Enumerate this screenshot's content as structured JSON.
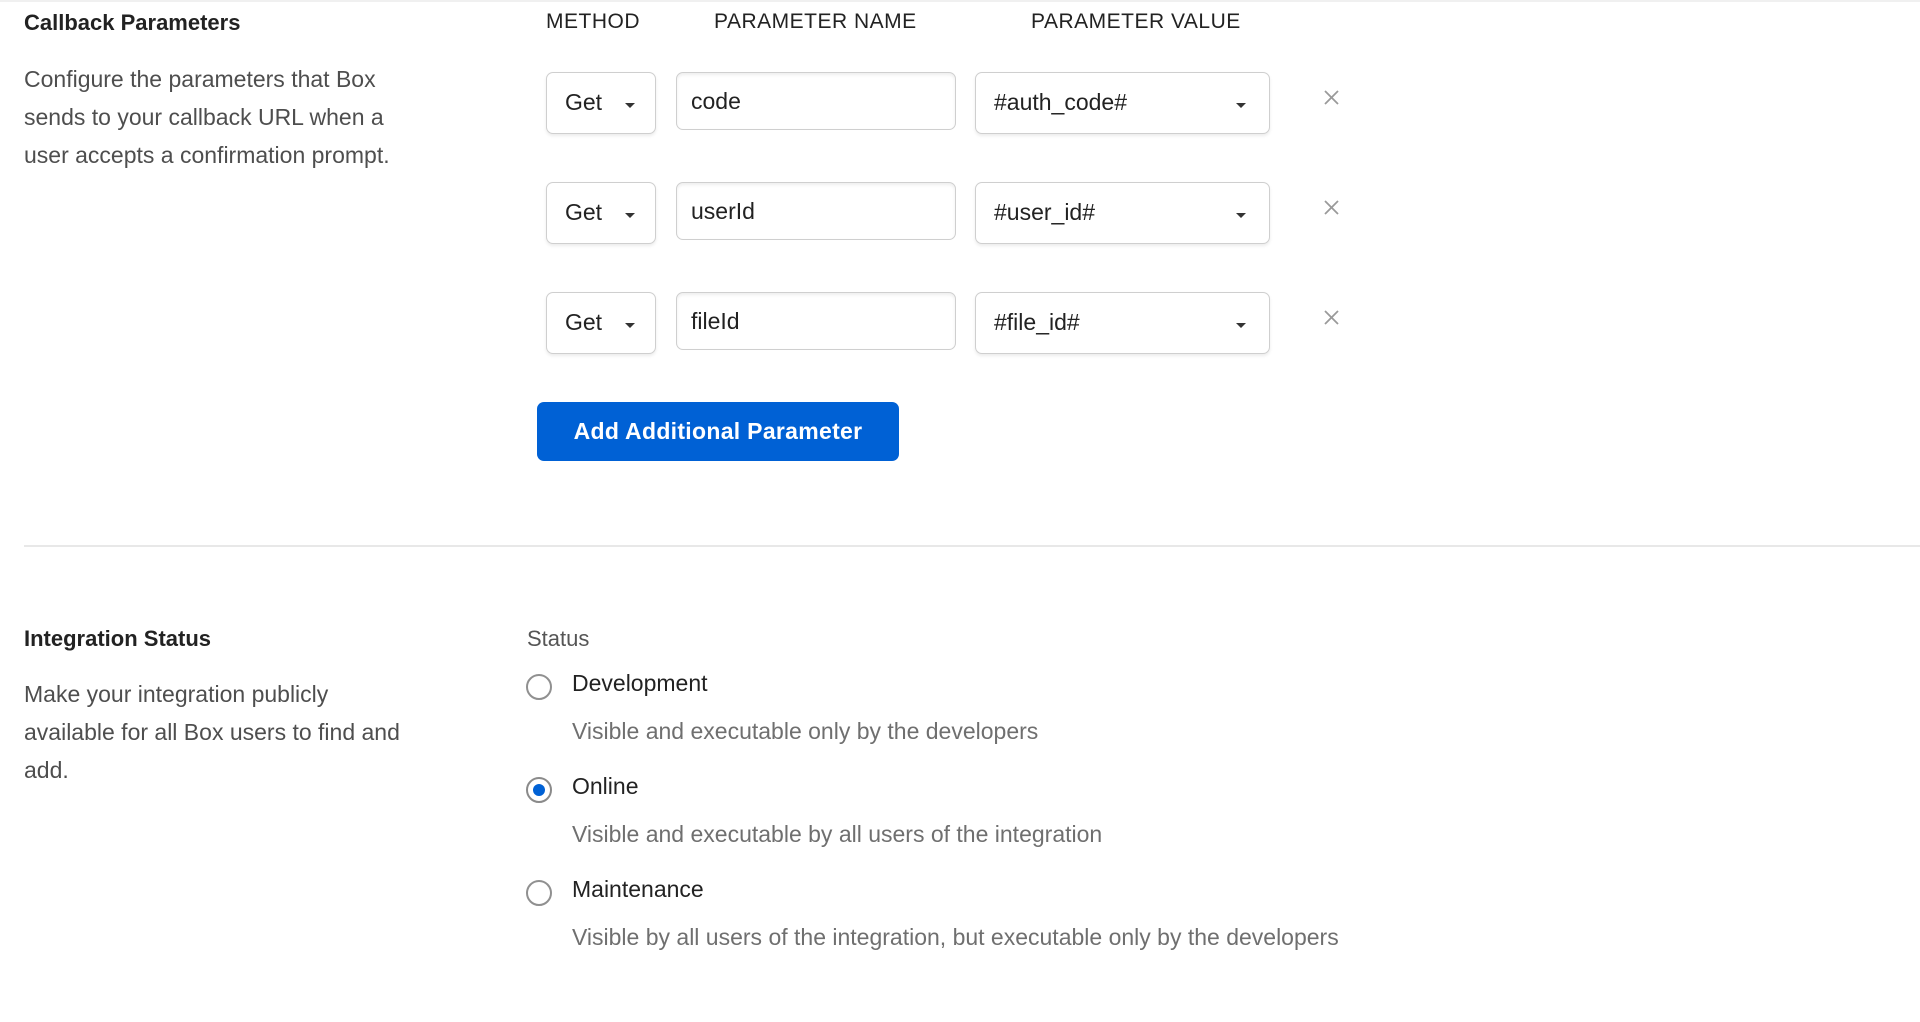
{
  "callback": {
    "title": "Callback Parameters",
    "description_lines": [
      "Configure the parameters that Box",
      "sends to your callback URL when a",
      "user accepts a confirmation prompt."
    ],
    "headers": {
      "method": "METHOD",
      "name": "PARAMETER NAME",
      "value": "PARAMETER VALUE"
    },
    "rows": [
      {
        "method": "Get",
        "name": "code",
        "value": "#auth_code#"
      },
      {
        "method": "Get",
        "name": "userId",
        "value": "#user_id#"
      },
      {
        "method": "Get",
        "name": "fileId",
        "value": "#file_id#"
      }
    ],
    "add_button": "Add Additional Parameter",
    "remove_icon": "close-icon"
  },
  "integration_status": {
    "title": "Integration Status",
    "description_lines": [
      "Make your integration publicly",
      "available for all Box users to find and",
      "add."
    ],
    "status_label": "Status",
    "selected": "Online",
    "options": [
      {
        "label": "Development",
        "help": "Visible and executable only by the developers"
      },
      {
        "label": "Online",
        "help": "Visible and executable by all users of the integration"
      },
      {
        "label": "Maintenance",
        "help": "Visible by all users of the integration, but executable only by the developers"
      }
    ]
  },
  "colors": {
    "accent": "#0061d5"
  }
}
